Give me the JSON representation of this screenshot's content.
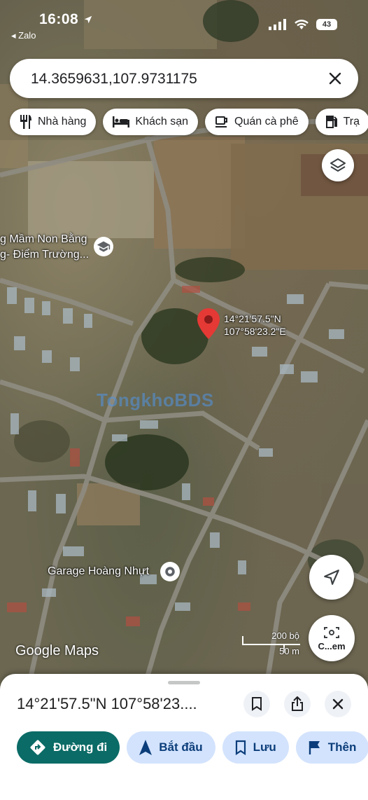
{
  "status_bar": {
    "time": "16:08",
    "back_app": "Zalo",
    "battery": "43"
  },
  "search": {
    "query": "14.3659631,107.9731175"
  },
  "chips": [
    {
      "label": "Nhà hàng",
      "icon": "restaurant-icon"
    },
    {
      "label": "Khách sạn",
      "icon": "hotel-icon"
    },
    {
      "label": "Quán cà phê",
      "icon": "coffee-icon"
    },
    {
      "label": "Trạ",
      "icon": "gas-station-icon"
    }
  ],
  "map": {
    "school_label_line1": "g Mầm Non Bằng",
    "school_label_line2": "g- Điểm Trường...",
    "pin_lat": "14°21'57.5\"N",
    "pin_lng": "107°58'23.2\"E",
    "garage_label": "Garage Hoàng Nhựt",
    "watermark": "TongkhoBDS",
    "attribution": "Google Maps",
    "scale_imperial": "200 bộ",
    "scale_metric": "50 m",
    "camera_label": "C...em"
  },
  "sheet": {
    "title": "14°21'57.5\"N 107°58'23....",
    "actions": [
      {
        "label": "Đường đi",
        "icon": "directions-icon"
      },
      {
        "label": "Bắt đầu",
        "icon": "navigation-icon"
      },
      {
        "label": "Lưu",
        "icon": "bookmark-icon"
      },
      {
        "label": "Thên",
        "icon": "flag-icon"
      }
    ]
  },
  "colors": {
    "primary_action": "#0b6b66",
    "secondary_action": "#d3e3fd",
    "pin": "#e53935"
  }
}
